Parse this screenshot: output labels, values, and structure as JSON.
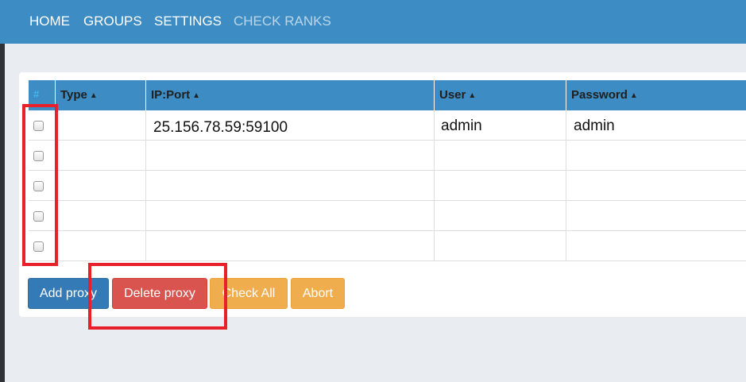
{
  "nav": {
    "items": [
      {
        "label": "HOME"
      },
      {
        "label": "GROUPS"
      },
      {
        "label": "SETTINGS"
      },
      {
        "label": "CHECK RANKS"
      }
    ]
  },
  "table": {
    "headers": {
      "hash": "#",
      "type": "Type",
      "ip_port": "IP:Port",
      "user": "User",
      "password": "Password"
    },
    "sort_icon": "sort-icon",
    "rows": [
      {
        "type": "",
        "ip_port": "25.156.78.59:59100",
        "user": "admin",
        "password": "admin",
        "checked": false
      },
      {
        "type": "",
        "ip_port": "",
        "user": "",
        "password": "",
        "checked": false
      },
      {
        "type": "",
        "ip_port": "",
        "user": "",
        "password": "",
        "checked": false
      },
      {
        "type": "",
        "ip_port": "",
        "user": "",
        "password": "",
        "checked": false
      },
      {
        "type": "",
        "ip_port": "",
        "user": "",
        "password": "",
        "checked": false
      }
    ]
  },
  "actions": {
    "add_proxy": "Add proxy",
    "delete_proxy": "Delete proxy",
    "check_all": "Check All",
    "abort": "Abort"
  },
  "colors": {
    "navbar": "#3d8dc4",
    "highlight": "#e8202a",
    "primary": "#337ab7",
    "danger": "#d9534f",
    "warning": "#f0ad4e"
  }
}
